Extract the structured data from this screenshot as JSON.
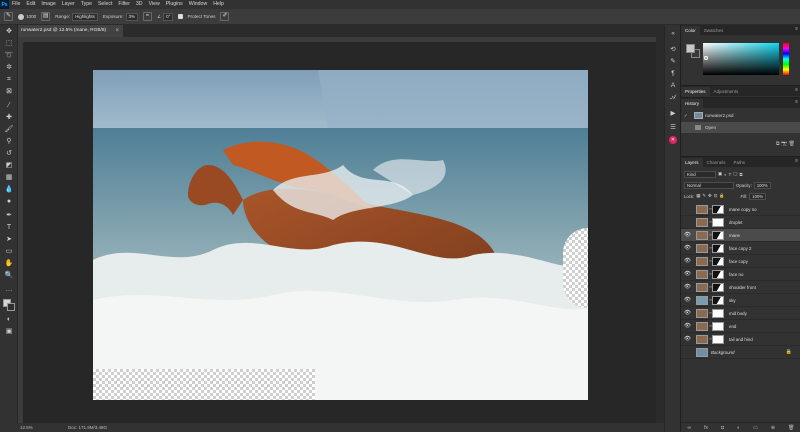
{
  "app": {
    "logo": "Ps",
    "menu": [
      "File",
      "Edit",
      "Image",
      "Layer",
      "Type",
      "Select",
      "Filter",
      "3D",
      "View",
      "Plugins",
      "Window",
      "Help"
    ]
  },
  "options": {
    "size_value": "1000",
    "range_label": "Range:",
    "range_value": "Highlights",
    "exposure_label": "Exposure:",
    "exposure_value": "3%",
    "angle_value": "0°",
    "protect_tones_label": "Protect Tones"
  },
  "document": {
    "tab_title": "runwater2.psd @ 12.5% (mane, RGB/8)",
    "close_glyph": "×",
    "zoom": "12.5%",
    "doc_size": "Doc: 171.9M/3.48G"
  },
  "panels": {
    "color_tabs": [
      "Color",
      "Swatches"
    ],
    "props_tabs": [
      "Properties",
      "Adjustments"
    ],
    "history_tabs": [
      "History"
    ],
    "history_items": [
      {
        "label": "runwater2.psd",
        "kind": "snapshot"
      },
      {
        "label": "Open",
        "kind": "step"
      }
    ],
    "layers_tabs": [
      "Layers",
      "Channels",
      "Paths"
    ],
    "kind_filter": "Kind",
    "blend_mode": "Normal",
    "opacity_label": "Opacity:",
    "opacity_value": "100%",
    "lock_label": "Lock:",
    "fill_label": "Fill:",
    "fill_value": "100%",
    "layers": [
      {
        "name": "mane copy no",
        "visible": false,
        "mask": "dark",
        "selected": false
      },
      {
        "name": "droplet",
        "visible": false,
        "mask": "white",
        "selected": false
      },
      {
        "name": "mane",
        "visible": true,
        "mask": "dark",
        "selected": true
      },
      {
        "name": "face copy 2",
        "visible": true,
        "mask": "dark",
        "selected": false
      },
      {
        "name": "face copy",
        "visible": true,
        "mask": "dark",
        "selected": false
      },
      {
        "name": "face no",
        "visible": true,
        "mask": "dark",
        "selected": false
      },
      {
        "name": "shoulder front",
        "visible": true,
        "mask": "dark",
        "selected": false
      },
      {
        "name": "sky",
        "visible": true,
        "mask": "dark",
        "selected": false
      },
      {
        "name": "mid body",
        "visible": true,
        "mask": "white",
        "selected": false
      },
      {
        "name": "end",
        "visible": true,
        "mask": "white",
        "selected": false
      },
      {
        "name": "tail and hind",
        "visible": true,
        "mask": "white",
        "selected": false
      },
      {
        "name": "Background",
        "visible": false,
        "mask": "none",
        "selected": false
      }
    ]
  },
  "colors": {
    "accent": "#31a8ff",
    "picker_hue": "#10d6f0"
  }
}
